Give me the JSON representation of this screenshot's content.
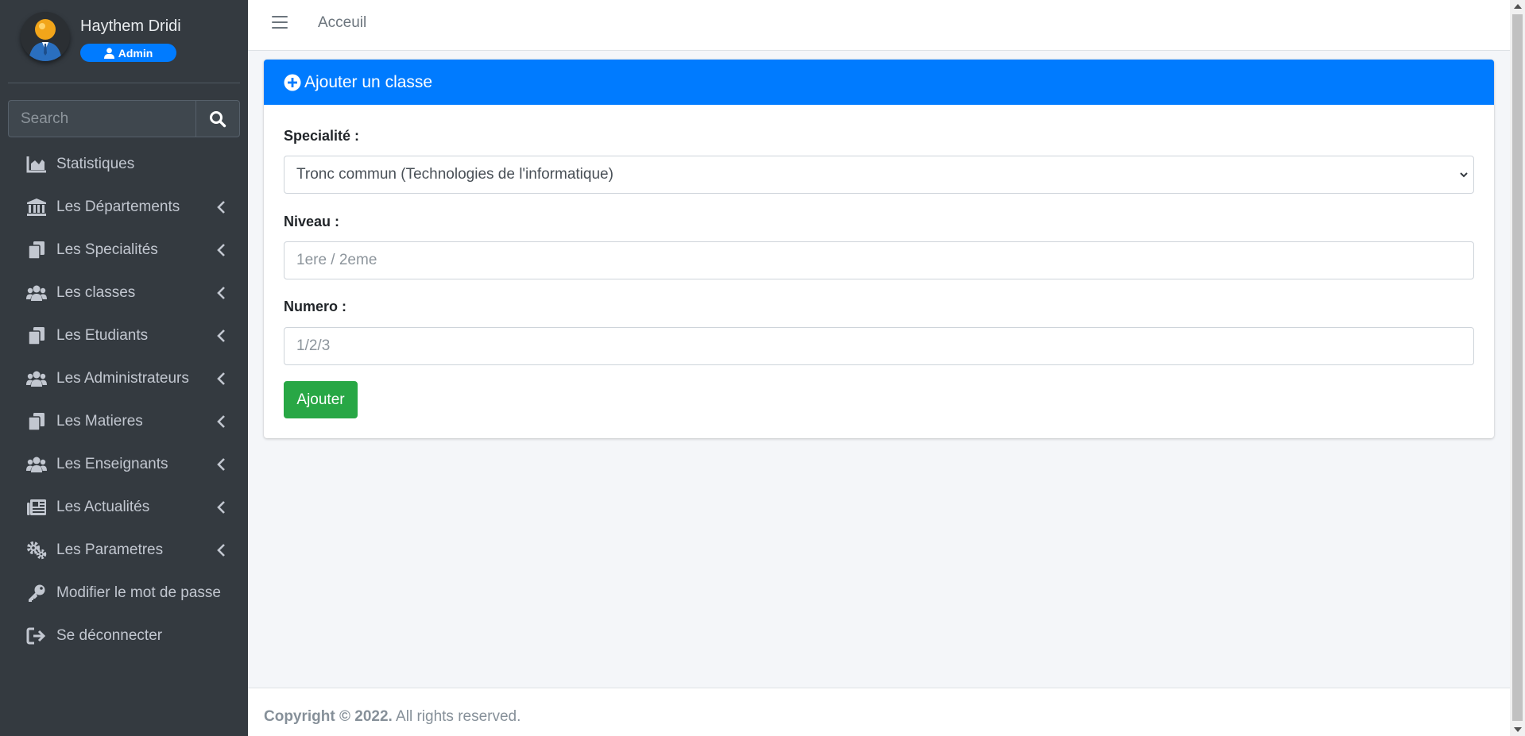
{
  "user": {
    "name": "Haythem Dridi",
    "role": "Admin"
  },
  "search": {
    "placeholder": "Search"
  },
  "sidebar": {
    "items": [
      {
        "label": "Statistiques",
        "icon": "chart-area-icon",
        "expandable": false
      },
      {
        "label": "Les Départements",
        "icon": "university-icon",
        "expandable": true
      },
      {
        "label": "Les Specialités",
        "icon": "copy-icon",
        "expandable": true
      },
      {
        "label": "Les classes",
        "icon": "users-icon",
        "expandable": true
      },
      {
        "label": "Les Etudiants",
        "icon": "copy-icon",
        "expandable": true
      },
      {
        "label": "Les Administrateurs",
        "icon": "users-icon",
        "expandable": true
      },
      {
        "label": "Les Matieres",
        "icon": "copy-icon",
        "expandable": true
      },
      {
        "label": "Les Enseignants",
        "icon": "users-icon",
        "expandable": true
      },
      {
        "label": "Les Actualités",
        "icon": "newspaper-icon",
        "expandable": true
      },
      {
        "label": "Les Parametres",
        "icon": "cogs-icon",
        "expandable": true
      },
      {
        "label": "Modifier le mot de passe",
        "icon": "key-icon",
        "expandable": false
      },
      {
        "label": "Se déconnecter",
        "icon": "sign-out-icon",
        "expandable": false
      }
    ]
  },
  "topbar": {
    "home_link": "Acceuil"
  },
  "card": {
    "title": "Ajouter un classe",
    "specialite": {
      "label": "Specialité :",
      "value": "Tronc commun (Technologies de l'informatique)"
    },
    "niveau": {
      "label": "Niveau :",
      "placeholder": "1ere / 2eme"
    },
    "numero": {
      "label": "Numero :",
      "placeholder": "1/2/3"
    },
    "submit_label": "Ajouter"
  },
  "footer": {
    "copyright": "Copyright © 2022.",
    "rights": " All rights reserved."
  },
  "colors": {
    "primary": "#007bff",
    "success": "#28a745",
    "sidebar": "#343a40"
  }
}
